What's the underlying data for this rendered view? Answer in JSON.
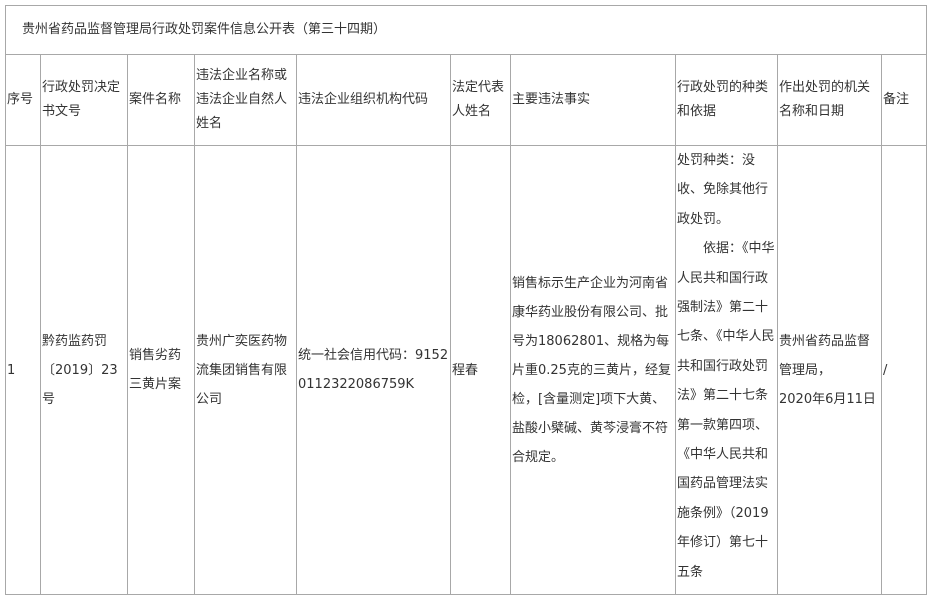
{
  "title": "贵州省药品监督管理局行政处罚案件信息公开表（第三十四期）",
  "headers": {
    "seq": "序号",
    "decision_no": "行政处罚决定书文号",
    "case_name": "案件名称",
    "violator_name": "违法企业名称或违法企业自然人姓名",
    "org_code": "违法企业组织机构代码",
    "legal_rep": "法定代表人姓名",
    "main_facts": "主要违法事实",
    "penalty_type_basis": "行政处罚的种类和依据",
    "authority_date": "作出处罚的机关名称和日期",
    "remarks": "备注"
  },
  "rows": [
    {
      "seq": "1",
      "decision_no": "黔药监药罚〔2019〕23号",
      "case_name": "销售劣药三黄片案",
      "violator_name": "贵州广奕医药物流集团销售有限公司",
      "org_code": "统一社会信用代码：91520112322086759K",
      "legal_rep": "程春",
      "main_facts": "销售标示生产企业为河南省康华药业股份有限公司、批号为18062801、规格为每片重0.25克的三黄片，经复检，[含量测定]项下大黄、盐酸小檗碱、黄芩浸膏不符合规定。",
      "penalty_type": "处罚种类：没收、免除其他行政处罚。",
      "penalty_basis": "依据：《中华人民共和国行政强制法》第二十七条、《中华人民共和国行政处罚法》第二十七条第一款第四项、《中华人民共和国药品管理法实施条例》（2019年修订）第七十五条",
      "authority": "贵州省药品监督管理局，",
      "date": "2020年6月11日",
      "remarks": "/"
    }
  ]
}
